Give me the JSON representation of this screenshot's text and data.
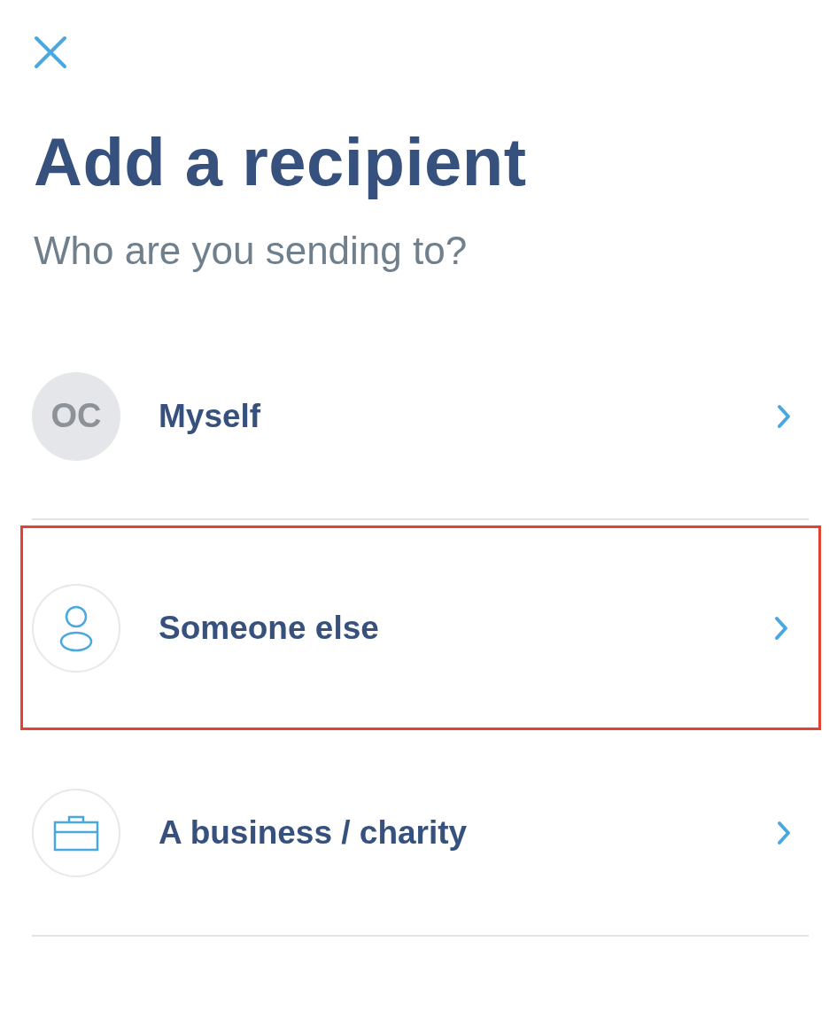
{
  "title": "Add a recipient",
  "subtitle": "Who are you sending to?",
  "options": [
    {
      "kind": "initials",
      "initials": "OC",
      "label": "Myself",
      "highlighted": false
    },
    {
      "kind": "person",
      "label": "Someone else",
      "highlighted": true
    },
    {
      "kind": "briefcase",
      "label": "A business / charity",
      "highlighted": false
    }
  ]
}
